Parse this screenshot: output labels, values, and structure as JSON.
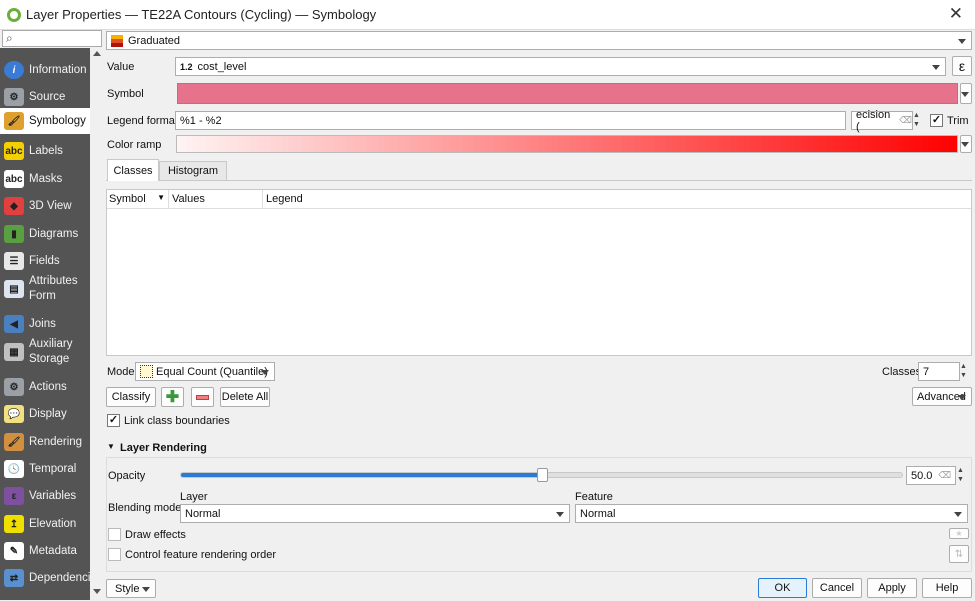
{
  "window": {
    "title": "Layer Properties — TE22A Contours (Cycling) — Symbology",
    "close": "✕"
  },
  "sidebar": {
    "search_placeholder": "",
    "items": [
      {
        "label": "Information",
        "icon": "info-icon",
        "color": "#3a7bd5",
        "glyph": "i"
      },
      {
        "label": "Source",
        "icon": "wrench-icon",
        "color": "#9aa0a6",
        "glyph": "⚙"
      },
      {
        "label": "Symbology",
        "icon": "brush-icon",
        "color": "#e0a030",
        "glyph": "🖌"
      },
      {
        "label": "Labels",
        "icon": "labels-icon",
        "color": "#f5d000",
        "glyph": "abc"
      },
      {
        "label": "Masks",
        "icon": "masks-icon",
        "color": "#ffffff",
        "glyph": "abc"
      },
      {
        "label": "3D View",
        "icon": "cube-icon",
        "color": "#e04040",
        "glyph": "◆"
      },
      {
        "label": "Diagrams",
        "icon": "diagram-icon",
        "color": "#5aa040",
        "glyph": "▮"
      },
      {
        "label": "Fields",
        "icon": "fields-icon",
        "color": "#e8e8e8",
        "glyph": "☰"
      },
      {
        "label": "Attributes\nForm",
        "icon": "form-icon",
        "color": "#dde6f0",
        "glyph": "▤"
      },
      {
        "label": "Joins",
        "icon": "joins-icon",
        "color": "#4a7fc0",
        "glyph": "◀"
      },
      {
        "label": "Auxiliary\nStorage",
        "icon": "storage-icon",
        "color": "#c0c0c0",
        "glyph": "▦"
      },
      {
        "label": "Actions",
        "icon": "actions-icon",
        "color": "#9aa0a6",
        "glyph": "⚙"
      },
      {
        "label": "Display",
        "icon": "display-icon",
        "color": "#f0e080",
        "glyph": "💬"
      },
      {
        "label": "Rendering",
        "icon": "rendering-icon",
        "color": "#d09040",
        "glyph": "🖌"
      },
      {
        "label": "Temporal",
        "icon": "clock-icon",
        "color": "#ffffff",
        "glyph": "🕓"
      },
      {
        "label": "Variables",
        "icon": "epsilon-icon",
        "color": "#8050a0",
        "glyph": "ε"
      },
      {
        "label": "Elevation",
        "icon": "elevation-icon",
        "color": "#f0e000",
        "glyph": "↥"
      },
      {
        "label": "Metadata",
        "icon": "metadata-icon",
        "color": "#ffffff",
        "glyph": "✎"
      },
      {
        "label": "Dependencies",
        "icon": "dependencies-icon",
        "color": "#5a90d0",
        "glyph": "⇄"
      }
    ]
  },
  "renderer": {
    "value": "Graduated"
  },
  "form": {
    "value_label": "Value",
    "value_type": "1.2",
    "value_field": "cost_level",
    "epsilon": "ε",
    "symbol_label": "Symbol",
    "symbol_color": "#e7728c",
    "legend_label": "Legend format",
    "legend_value": "%1 - %2",
    "precision_value": "ecision (",
    "trim_label": "Trim",
    "trim_checked": "✓",
    "ramp_label": "Color ramp",
    "ramp_start": "#fff4f4",
    "ramp_end": "#ff0000"
  },
  "tabs": [
    {
      "label": "Classes"
    },
    {
      "label": "Histogram"
    }
  ],
  "table": {
    "columns": [
      "Symbol",
      "Values",
      "Legend"
    ]
  },
  "mode": {
    "label": "Mode",
    "value": "Equal Count (Quantile)",
    "classes_label": "Classes",
    "classes_value": "7"
  },
  "buttons": {
    "classify": "Classify",
    "delete_all": "Delete All",
    "advanced": "Advanced",
    "style": "Style",
    "ok": "OK",
    "cancel": "Cancel",
    "apply": "Apply",
    "help": "Help"
  },
  "link_boundaries": {
    "label": "Link class boundaries",
    "checked": "✓"
  },
  "layer_rendering": {
    "title": "Layer Rendering",
    "opacity_label": "Opacity",
    "opacity_value": "50.0",
    "opacity_percent": 50,
    "blending_label": "Blending mode",
    "layer_label": "Layer",
    "layer_value": "Normal",
    "feature_label": "Feature",
    "feature_value": "Normal",
    "draw_effects": "Draw effects",
    "control_order": "Control feature rendering order"
  }
}
